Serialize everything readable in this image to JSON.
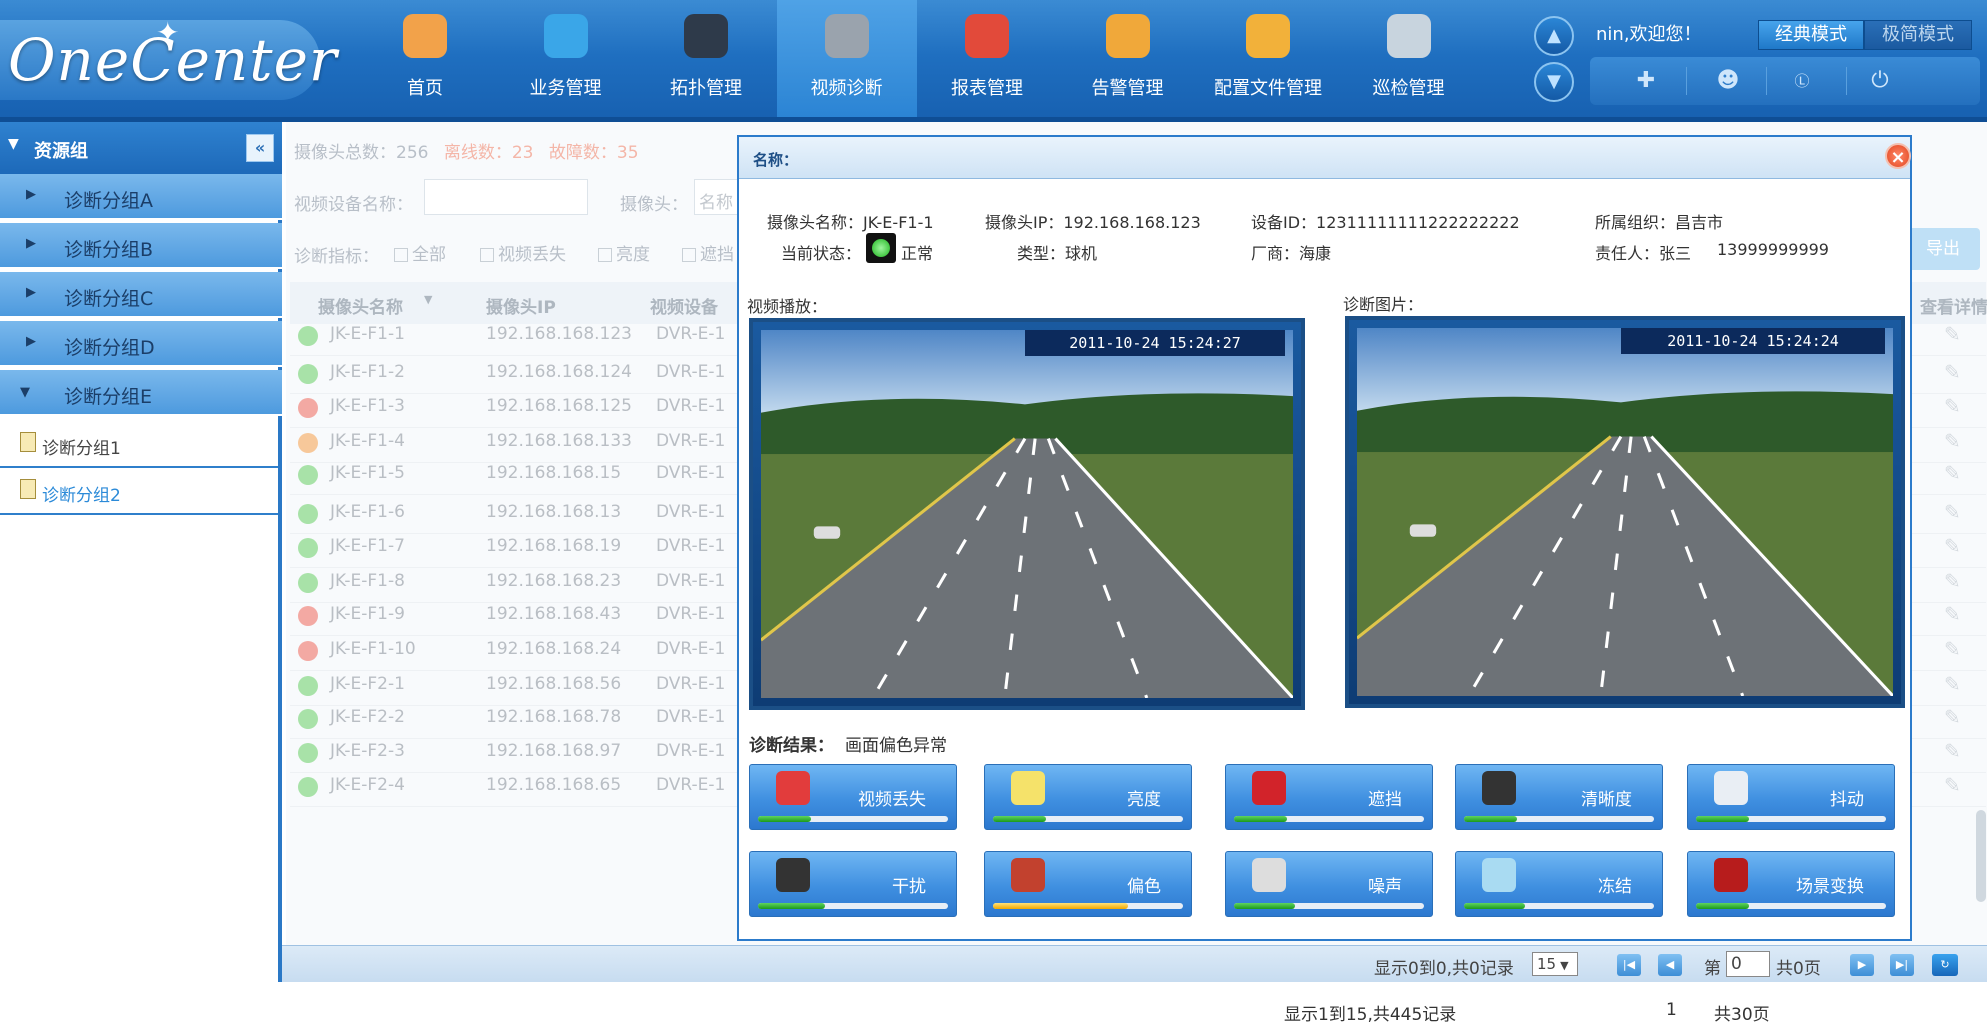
{
  "header": {
    "logo": "OneCenter",
    "welcome": "nin,欢迎您！",
    "mode_classic": "经典模式",
    "mode_simple": "极简模式",
    "nav": [
      {
        "label": "首页",
        "icon": "home-icon"
      },
      {
        "label": "业务管理",
        "icon": "globe-icon"
      },
      {
        "label": "拓扑管理",
        "icon": "topology-icon"
      },
      {
        "label": "视频诊断",
        "icon": "server-icon"
      },
      {
        "label": "报表管理",
        "icon": "pie-chart-icon"
      },
      {
        "label": "告警管理",
        "icon": "alarm-icon"
      },
      {
        "label": "配置文件管理",
        "icon": "folder-icon"
      },
      {
        "label": "巡检管理",
        "icon": "box-icon"
      }
    ]
  },
  "sidebar": {
    "title": "资源组",
    "groups": [
      "诊断分组A",
      "诊断分组B",
      "诊断分组C",
      "诊断分组D",
      "诊断分组E"
    ],
    "subgroups": [
      "诊断分组1",
      "诊断分组2"
    ]
  },
  "list": {
    "stats": {
      "total_label": "摄像头总数：256",
      "offline_label": "离线数：23",
      "fault_label": "故障数：35"
    },
    "filter": {
      "device_name_label": "视频设备名称：",
      "camera_label": "摄像头：",
      "camera_placeholder": "名称",
      "metric_label": "诊断指标：",
      "checks": [
        "全部",
        "视频丢失",
        "亮度",
        "遮挡"
      ]
    },
    "columns": [
      "摄像头名称",
      "摄像头IP",
      "视频设备",
      "查看详情"
    ],
    "export_label": "导出",
    "rows": [
      {
        "name": "JK-E-F1-1",
        "ip": "192.168.168.123",
        "dev": "DVR-E-1",
        "status": "green"
      },
      {
        "name": "JK-E-F1-2",
        "ip": "192.168.168.124",
        "dev": "DVR-E-1",
        "status": "green"
      },
      {
        "name": "JK-E-F1-3",
        "ip": "192.168.168.125",
        "dev": "DVR-E-1",
        "status": "red"
      },
      {
        "name": "JK-E-F1-4",
        "ip": "192.168.168.133",
        "dev": "DVR-E-1",
        "status": "orange"
      },
      {
        "name": "JK-E-F1-5",
        "ip": "192.168.168.15",
        "dev": "DVR-E-1",
        "status": "green"
      },
      {
        "name": "JK-E-F1-6",
        "ip": "192.168.168.13",
        "dev": "DVR-E-1",
        "status": "green"
      },
      {
        "name": "JK-E-F1-7",
        "ip": "192.168.168.19",
        "dev": "DVR-E-1",
        "status": "green"
      },
      {
        "name": "JK-E-F1-8",
        "ip": "192.168.168.23",
        "dev": "DVR-E-1",
        "status": "green"
      },
      {
        "name": "JK-E-F1-9",
        "ip": "192.168.168.43",
        "dev": "DVR-E-1",
        "status": "red"
      },
      {
        "name": "JK-E-F1-10",
        "ip": "192.168.168.24",
        "dev": "DVR-E-1",
        "status": "red"
      },
      {
        "name": "JK-E-F2-1",
        "ip": "192.168.168.56",
        "dev": "DVR-E-1",
        "status": "green"
      },
      {
        "name": "JK-E-F2-2",
        "ip": "192.168.168.78",
        "dev": "DVR-E-1",
        "status": "green"
      },
      {
        "name": "JK-E-F2-3",
        "ip": "192.168.168.97",
        "dev": "DVR-E-1",
        "status": "green"
      },
      {
        "name": "JK-E-F2-4",
        "ip": "192.168.168.65",
        "dev": "DVR-E-1",
        "status": "green"
      }
    ]
  },
  "pagination": {
    "display": "显示0到0,共0记录",
    "page_size": "15",
    "page_label": "第",
    "page_value": "0",
    "total_pages": "共0页"
  },
  "bottom": {
    "display": "显示1到15,共445记录",
    "page": "1",
    "total_pages": "共30页"
  },
  "modal": {
    "title": "名称：",
    "info": {
      "camera_name": "摄像头名称：JK-E-F1-1",
      "camera_ip": "摄像头IP：192.168.168.123",
      "device_id": "设备ID：12311111111222222222",
      "org": "所属组织：昌吉市",
      "status_label": "当前状态：",
      "status_value": "正常",
      "type": "类型：球机",
      "vendor": "厂商：海康",
      "owner": "责任人：张三",
      "phone": "13999999999"
    },
    "video_label": "视频播放：",
    "image_label": "诊断图片：",
    "video_timestamp": "2011-10-24 15:24:27",
    "image_timestamp": "2011-10-24 15:24:24",
    "result_label": "诊断结果：",
    "result_value": "画面偏色异常",
    "metrics": [
      {
        "label": "视频丢失",
        "icon": "camera-icon",
        "level": 0.28,
        "warn": false
      },
      {
        "label": "亮度",
        "icon": "bulb-icon",
        "level": 0.28,
        "warn": false
      },
      {
        "label": "遮挡",
        "icon": "block-icon",
        "level": 0.28,
        "warn": false
      },
      {
        "label": "清晰度",
        "icon": "lens-icon",
        "level": 0.28,
        "warn": false
      },
      {
        "label": "抖动",
        "icon": "shake-icon",
        "level": 0.28,
        "warn": false
      },
      {
        "label": "干扰",
        "icon": "interference-icon",
        "level": 0.35,
        "warn": false
      },
      {
        "label": "偏色",
        "icon": "color-cast-icon",
        "level": 0.71,
        "warn": true
      },
      {
        "label": "噪声",
        "icon": "noise-icon",
        "level": 0.32,
        "warn": false
      },
      {
        "label": "冻结",
        "icon": "freeze-icon",
        "level": 0.32,
        "warn": false
      },
      {
        "label": "场景变换",
        "icon": "scene-change-icon",
        "level": 0.28,
        "warn": false
      }
    ]
  }
}
